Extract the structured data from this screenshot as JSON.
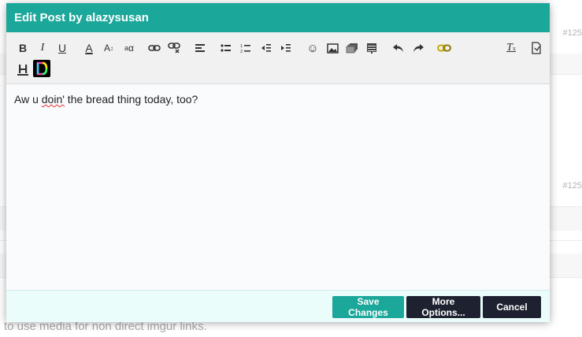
{
  "background": {
    "post_numbers": [
      "#125",
      "#125"
    ],
    "footer_text": "to use media for non direct imgur links."
  },
  "modal": {
    "title": "Edit Post by alazysusan",
    "editor_text_before": "Aw u ",
    "editor_text_misspelled": "doin'",
    "editor_text_after": " the bread thing today, too?",
    "buttons": {
      "save": "Save Changes",
      "more": "More Options...",
      "cancel": "Cancel"
    }
  },
  "toolbar": {
    "icons": [
      "bold-icon",
      "italic-icon",
      "underline-icon",
      "font-color-icon",
      "font-size-icon",
      "font-name-icon",
      "link-icon",
      "unlink-icon",
      "align-icon",
      "bullet-list-icon",
      "numbered-list-icon",
      "outdent-icon",
      "indent-icon",
      "emoji-icon",
      "image-icon",
      "media-icon",
      "table-icon",
      "undo-icon",
      "redo-icon",
      "chain-icon",
      "clear-format-icon",
      "source-icon",
      "header-icon",
      "d-logo-icon"
    ]
  },
  "colors": {
    "header": "#1ba799",
    "dark_button": "#1e2130",
    "footer_bg": "#ebfdfb"
  }
}
